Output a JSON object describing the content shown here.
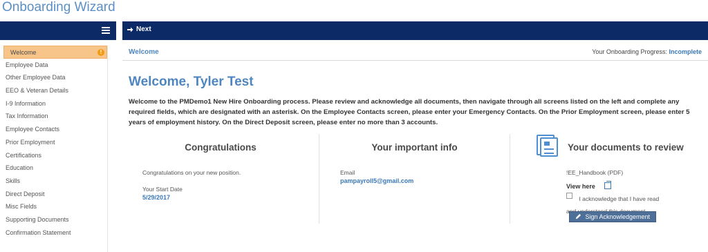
{
  "app": {
    "title": "Onboarding Wizard"
  },
  "toolbar": {
    "next_label": "Next",
    "menu_icon": "hamburger-menu-icon",
    "next_icon": "arrow-right-icon"
  },
  "sidebar": {
    "items": [
      {
        "label": "Welcome",
        "active": true,
        "warning": true
      },
      {
        "label": "Employee Data"
      },
      {
        "label": "Other Employee Data"
      },
      {
        "label": "EEO & Veteran Details"
      },
      {
        "label": "I-9 Information"
      },
      {
        "label": "Tax Information"
      },
      {
        "label": "Employee Contacts"
      },
      {
        "label": "Prior Employment"
      },
      {
        "label": "Certifications"
      },
      {
        "label": "Education"
      },
      {
        "label": "Skills"
      },
      {
        "label": "Direct Deposit"
      },
      {
        "label": "Misc Fields"
      },
      {
        "label": "Supporting Documents"
      },
      {
        "label": "Confirmation Statement"
      }
    ],
    "warning_glyph": "!"
  },
  "header": {
    "breadcrumb": "Welcome",
    "progress_label": "Your Onboarding Progress:",
    "progress_value": "Incomplete"
  },
  "main": {
    "title": "Welcome, Tyler Test",
    "intro": "Welcome to the PMDemo1 New Hire Onboarding process. Please review and acknowledge all documents, then navigate through all screens listed on the left and complete any required fields, which are designated with an asterisk. On the Employee Contacts screen, please enter your Emergency Contacts. On the Prior Employment screen, please enter 5 years of employment history. On the Direct Deposit screen, please enter no more than 3 accounts."
  },
  "congrats": {
    "title": "Congratulations",
    "message": "Congratulations on your new position.",
    "start_label": "Your Start Date",
    "start_value": "5/29/2017"
  },
  "info": {
    "title": "Your important info",
    "email_label": "Email",
    "email_value": "pampayroll5@gmail.com"
  },
  "documents": {
    "title": "Your documents to review",
    "doc_name": "!EE_Handbook (PDF)",
    "view_label": "View here",
    "ack_text": "I acknowledge that I have read and understood this document.",
    "sign_label": "Sign Acknowledgement",
    "sign_icon": "pencil-icon"
  },
  "colors": {
    "nav": "#0c2a66",
    "accent": "#4f86c0",
    "active": "#f7c58a",
    "warning": "#f39c12",
    "button": "#4e6f98"
  }
}
